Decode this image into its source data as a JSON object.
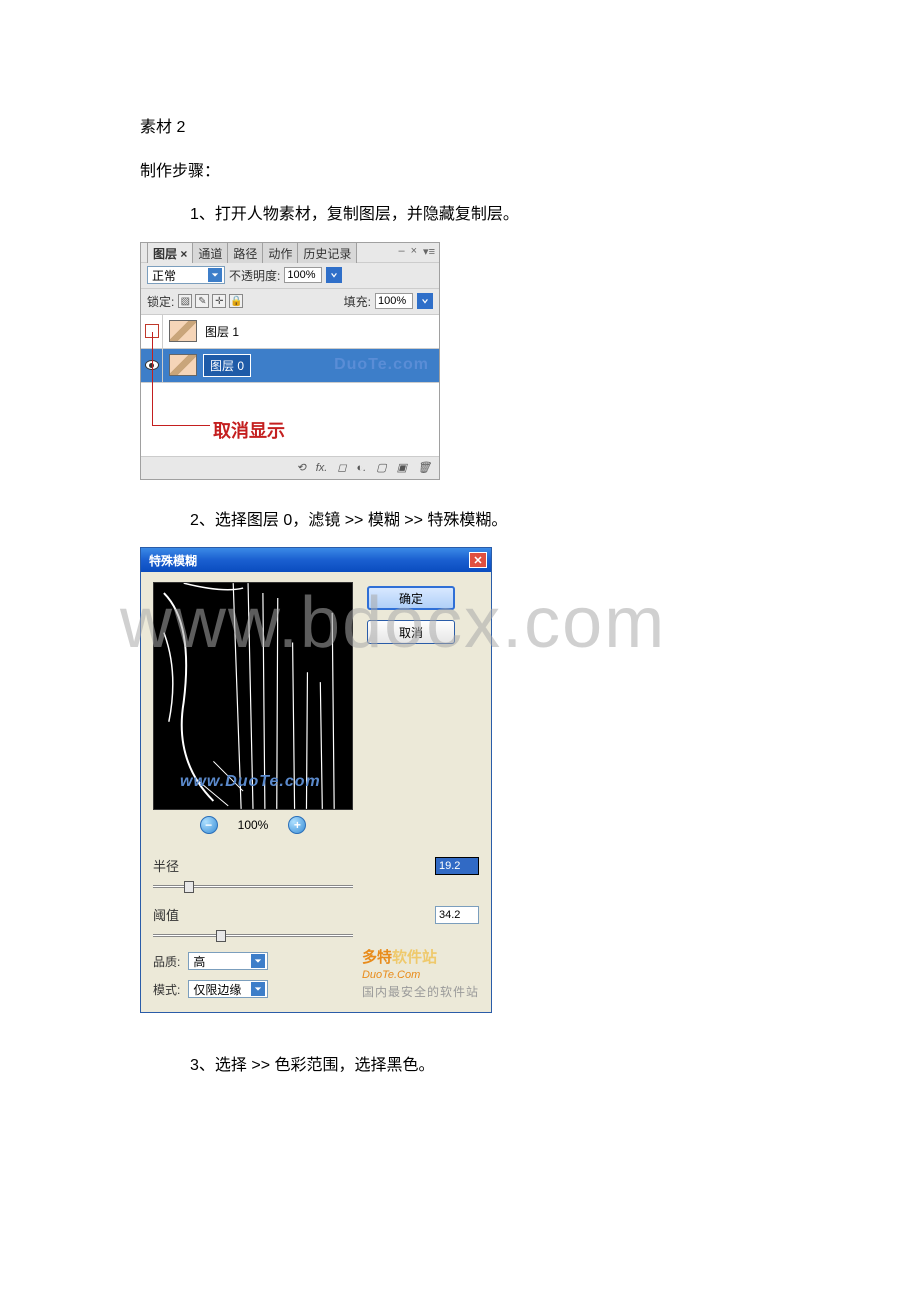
{
  "text": {
    "material": "素材 2",
    "steps_label": "制作步骤：",
    "step1": "1、打开人物素材，复制图层，并隐藏复制层。",
    "step2": "2、选择图层 0，滤镜 >> 模糊 >> 特殊模糊。",
    "step3": "3、选择 >> 色彩范围，选择黑色。"
  },
  "layers_panel": {
    "tabs": [
      "图层",
      "通道",
      "路径",
      "动作",
      "历史记录"
    ],
    "active_tab_index": 0,
    "blend_mode": "正常",
    "opacity_label": "不透明度:",
    "opacity_value": "100%",
    "lock_label": "锁定:",
    "fill_label": "填充:",
    "fill_value": "100%",
    "layers": [
      {
        "name": "图层 1",
        "visible": false,
        "selected": false
      },
      {
        "name": "图层 0",
        "visible": true,
        "selected": true
      }
    ],
    "watermark": "DuoTe.com",
    "annotation": "取消显示",
    "bottom_icons": [
      "⟲",
      "fx.",
      "◻",
      "◐.",
      "▢",
      "▣",
      "🗑"
    ]
  },
  "blur_dialog": {
    "title": "特殊模糊",
    "ok": "确定",
    "cancel": "取消",
    "zoom": "100%",
    "radius_label": "半径",
    "radius_value": "19.2",
    "threshold_label": "阈值",
    "threshold_value": "34.2",
    "quality_label": "品质:",
    "quality_value": "高",
    "mode_label": "模式:",
    "mode_value": "仅限边缘",
    "preview_watermark": "www.DuoTe.com",
    "duote": {
      "line1a": "多特",
      "line1b": "软件站",
      "line2": "DuoTe.Com",
      "line3": "国内最安全的软件站"
    }
  },
  "page_watermark": "www.bdocx.com"
}
